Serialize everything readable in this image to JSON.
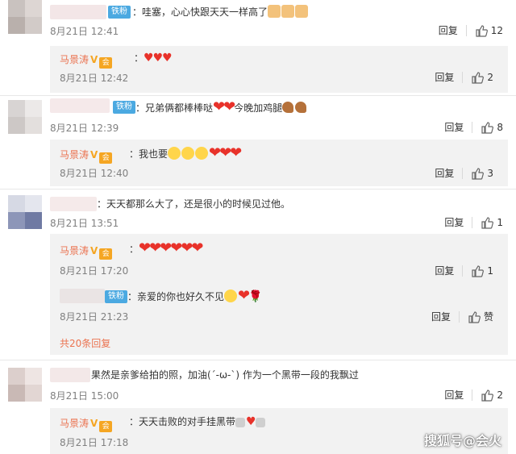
{
  "labels": {
    "reply": "回复",
    "like_zan": "赞"
  },
  "tag_text": "铁粉",
  "comments": [
    {
      "text": "：哇塞，心心快跟天天一样高了",
      "time": "8月21日 12:41",
      "likes": "12"
    },
    {
      "text": "：兄弟俩都棒棒哒",
      "text_after": "今晚加鸡腿",
      "time": "8月21日 12:39",
      "likes": "8"
    },
    {
      "text": "：天天都那么大了，还是很小的时候见过他。",
      "time": "8月21日 13:51",
      "likes": "1"
    },
    {
      "text": "果然是亲爹给拍的照，加油(´-ω-`) 作为一个黑带一段的我飘过",
      "time": "8月21日 15:00",
      "likes": "2"
    }
  ],
  "replies": [
    {
      "author": "马景涛",
      "time": "8月21日 12:42",
      "likes": "2"
    },
    {
      "author": "马景涛",
      "text": "：我也要",
      "time": "8月21日 12:40",
      "likes": "3"
    },
    {
      "author": "马景涛",
      "time": "8月21日 17:20",
      "likes": "1"
    },
    {
      "text": "：亲爱的你也好久不见",
      "time": "8月21日 21:23"
    },
    {
      "author": "马景涛",
      "text": "：天天击败的对手挂黑带",
      "time": "8月21日 17:18"
    }
  ],
  "more_replies": "共20条回复",
  "watermark": "搜狐号@会火",
  "badges": {
    "v": "V",
    "vip": "会"
  }
}
